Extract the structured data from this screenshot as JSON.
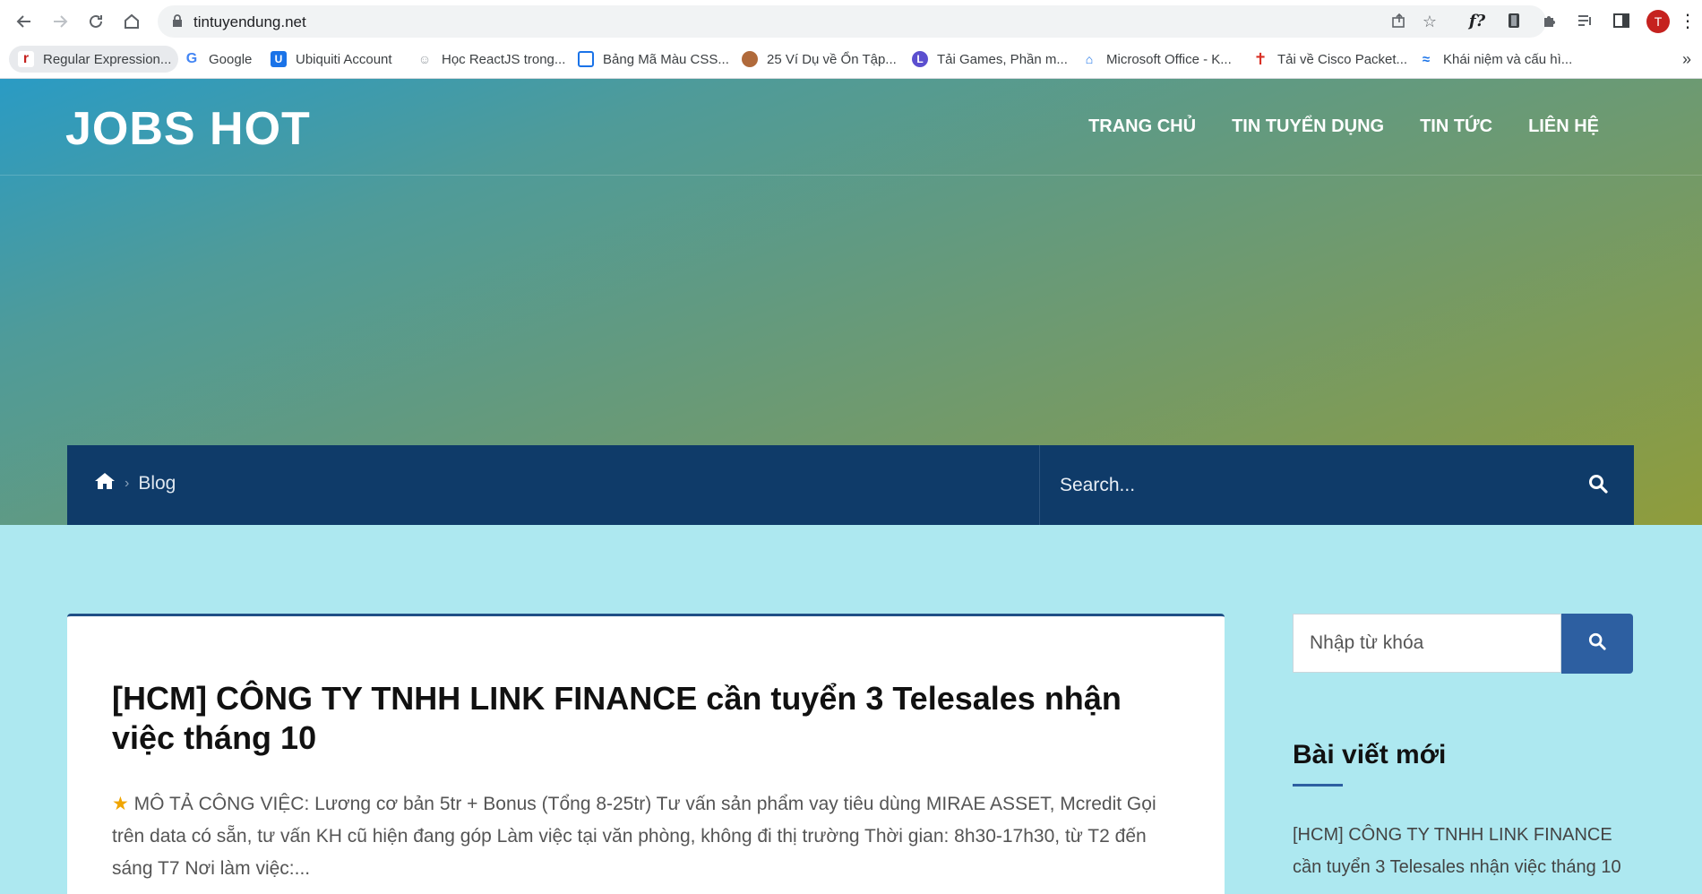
{
  "browser": {
    "url": "tintuyendung.net",
    "profile_initial": "T",
    "bookmarks": [
      {
        "label": "Regular Expression...",
        "color": "#c5221f",
        "glyph": "r"
      },
      {
        "label": "Google",
        "color": "#4285f4",
        "glyph": "G"
      },
      {
        "label": "Ubiquiti Account",
        "color": "#1a73e8",
        "glyph": "U"
      },
      {
        "label": "Học ReactJS trong...",
        "color": "#9aa0a6",
        "glyph": "☺"
      },
      {
        "label": "Bảng Mã Màu CSS...",
        "color": "#1a73e8",
        "glyph": "▦"
      },
      {
        "label": "25 Ví Dụ về Ổn Tập...",
        "color": "#b06a3b",
        "glyph": "◉"
      },
      {
        "label": "Tải Games, Phần m...",
        "color": "#5b4fcf",
        "glyph": "L"
      },
      {
        "label": "Microsoft Office - K...",
        "color": "#1a73e8",
        "glyph": "⌂"
      },
      {
        "label": "Tải về Cisco Packet...",
        "color": "#d93025",
        "glyph": "✝"
      },
      {
        "label": "Khái niệm và cấu hì...",
        "color": "#1a73e8",
        "glyph": "≈"
      }
    ],
    "more_bookmarks": "»"
  },
  "site": {
    "title": "JOBS HOT",
    "nav": [
      "TRANG CHỦ",
      "TIN TUYỂN DỤNG",
      "TIN TỨC",
      "LIÊN HỆ"
    ]
  },
  "breadcrumb": {
    "current": "Blog"
  },
  "header_search": {
    "placeholder": "Search..."
  },
  "post": {
    "title": "[HCM] CÔNG TY TNHH LINK FINANCE cần tuyển 3 Telesales nhận việc tháng 10",
    "excerpt": "MÔ TẢ CÔNG VIỆC: Lương cơ bản 5tr + Bonus (Tổng 8-25tr) Tư vấn sản phẩm vay tiêu dùng MIRAE ASSET, Mcredit Gọi trên data có sẵn, tư vấn KH cũ hiện đang góp Làm việc tại văn phòng, không đi thị trường Thời gian: 8h30-17h30, từ T2 đến sáng T7 Nơi làm việc:..."
  },
  "sidebar": {
    "search_placeholder": "Nhập từ khóa",
    "widget_title": "Bài viết mới",
    "recent_posts": [
      "[HCM] CÔNG TY TNHH LINK FINANCE cần tuyển 3 Telesales nhận việc tháng 10"
    ]
  },
  "colors": {
    "accent": "#2d5fa1",
    "breadcrumb_bar": "#0f3b69",
    "page_bg": "#ade8f0"
  }
}
